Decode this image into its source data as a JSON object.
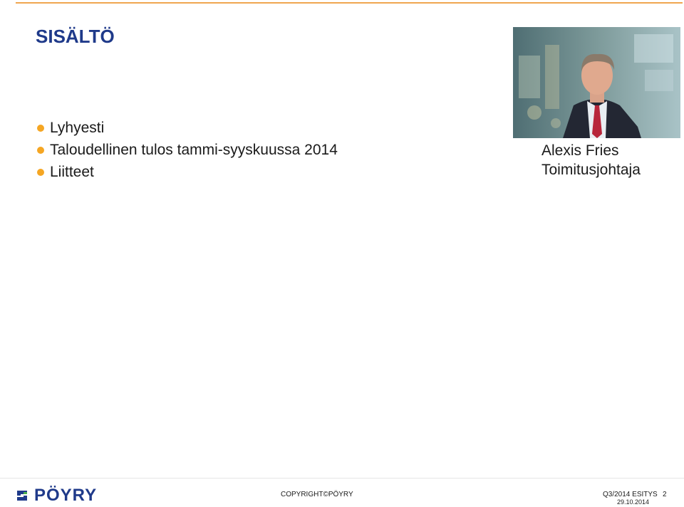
{
  "slide": {
    "title": "SISÄLTÖ",
    "agenda": [
      {
        "label": "Lyhyesti"
      },
      {
        "label": "Taloudellinen tulos tammi-syyskuussa 2014"
      },
      {
        "label": "Liitteet"
      }
    ]
  },
  "person": {
    "name": "Alexis Fries",
    "role": "Toimitusjohtaja"
  },
  "footer": {
    "logo_text": "PÖYRY",
    "copyright": "COPYRIGHT©PÖYRY",
    "code": "Q3/2014  ESITYS",
    "date": "29.10.2014",
    "page": "2"
  },
  "colors": {
    "title": "#1f3a8a",
    "bullet": "#f5a623",
    "top_rule": "#f0a650",
    "logo_blue": "#1f3a8a",
    "logo_green": "#4caf50"
  }
}
